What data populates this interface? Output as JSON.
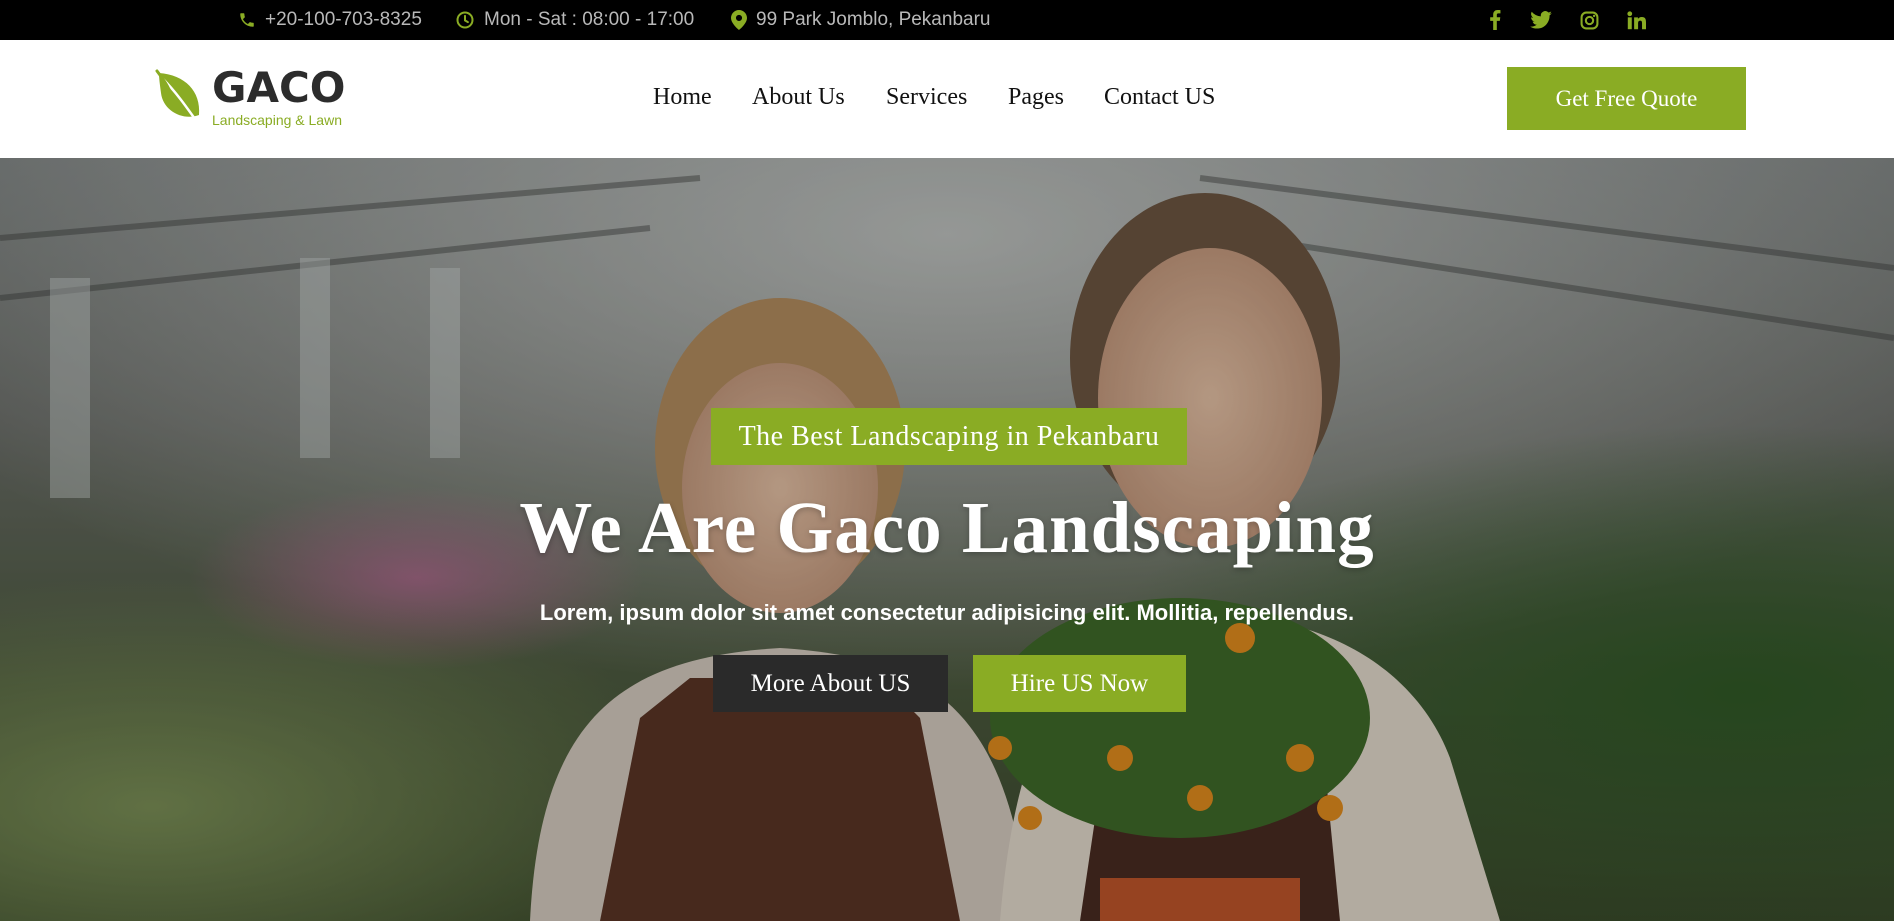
{
  "topbar": {
    "phone": "+20-100-703-8325",
    "hours": "Mon - Sat : 08:00 - 17:00",
    "address": "99 Park Jomblo, Pekanbaru",
    "icons": [
      "phone-icon",
      "clock-icon",
      "map-pin-icon"
    ],
    "social": [
      "facebook-icon",
      "twitter-icon",
      "instagram-icon",
      "linkedin-icon"
    ]
  },
  "header": {
    "logo_name": "GACO",
    "logo_tagline": "Landscaping & Lawn",
    "nav": [
      "Home",
      "About Us",
      "Services",
      "Pages",
      "Contact US"
    ],
    "cta": "Get Free Quote"
  },
  "hero": {
    "badge": "The Best Landscaping in Pekanbaru",
    "title": "We Are Gaco Landscaping",
    "subtitle": "Lorem, ipsum dolor sit amet consectetur adipisicing elit. Mollitia, repellendus.",
    "btn_more": "More About US",
    "btn_hire": "Hire US Now"
  },
  "colors": {
    "accent": "#8aac24",
    "topbar_bg": "#000000",
    "dark_button": "#2a2a2a"
  }
}
